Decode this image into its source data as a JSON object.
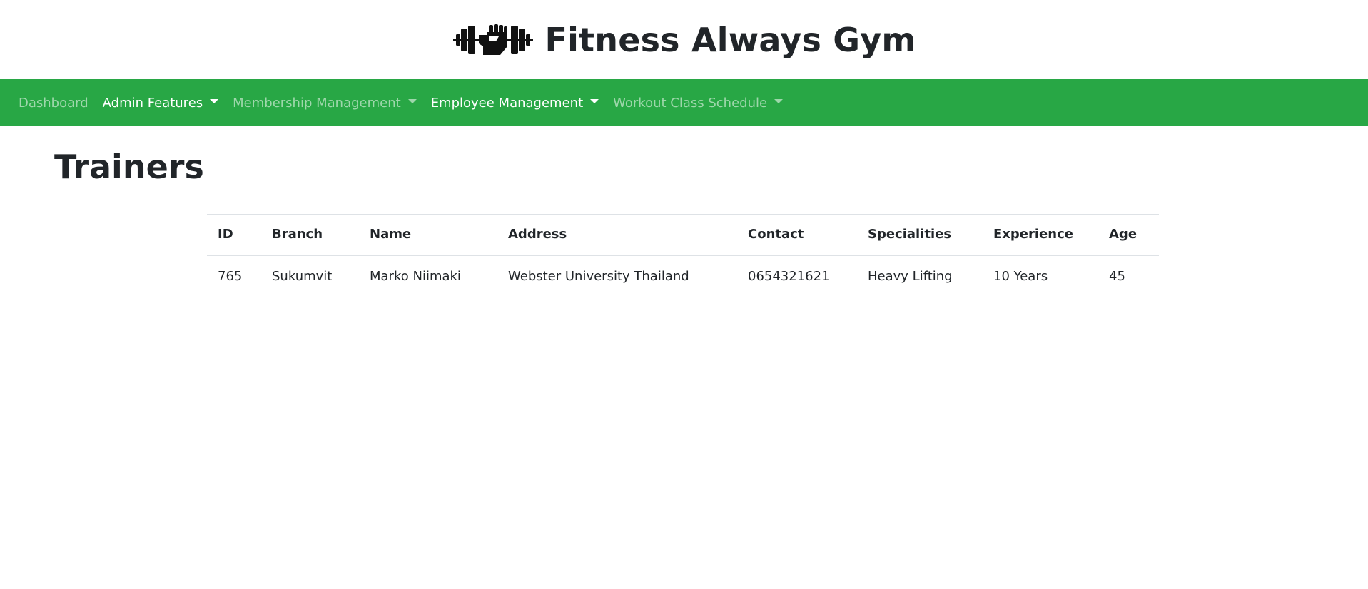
{
  "header": {
    "title": "Fitness Always Gym",
    "logo_icon": "dumbbell-fist-icon"
  },
  "navbar": {
    "background": "#28a745",
    "items": [
      {
        "label": "Dashboard",
        "dropdown": false,
        "active": false
      },
      {
        "label": "Admin Features",
        "dropdown": true,
        "active": true
      },
      {
        "label": "Membership Management",
        "dropdown": true,
        "active": false
      },
      {
        "label": "Employee Management",
        "dropdown": true,
        "active": true
      },
      {
        "label": "Workout Class Schedule",
        "dropdown": true,
        "active": false
      }
    ]
  },
  "main": {
    "title": "Trainers",
    "table": {
      "columns": [
        "ID",
        "Branch",
        "Name",
        "Address",
        "Contact",
        "Specialities",
        "Experience",
        "Age"
      ],
      "rows": [
        [
          "765",
          "Sukumvit",
          "Marko Niimaki",
          "Webster University Thailand",
          "0654321621",
          "Heavy Lifting",
          "10 Years",
          "45"
        ]
      ]
    }
  }
}
